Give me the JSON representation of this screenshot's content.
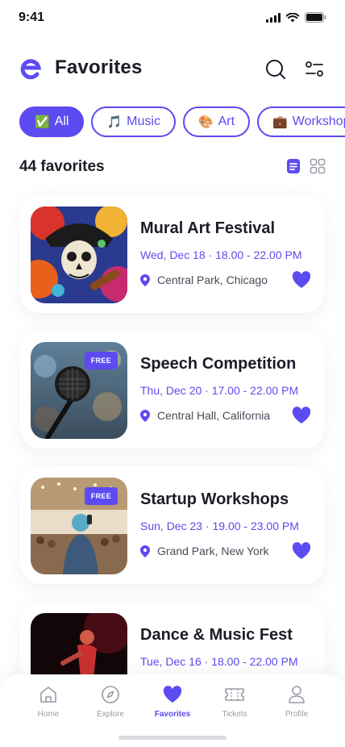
{
  "status_bar": {
    "time": "9:41"
  },
  "header": {
    "title": "Favorites",
    "search_icon": "search-icon",
    "filter_icon": "sliders-icon"
  },
  "chips": [
    {
      "emoji": "✅",
      "label": "All",
      "active": true
    },
    {
      "emoji": "🎵",
      "label": "Music",
      "active": false
    },
    {
      "emoji": "🎨",
      "label": "Art",
      "active": false
    },
    {
      "emoji": "💼",
      "label": "Workshops",
      "active": false
    }
  ],
  "count": {
    "text": "44 favorites",
    "active_view": "list"
  },
  "events": [
    {
      "title": "Mural Art Festival",
      "date": "Wed, Dec 18 · 18.00 - 22.00 PM",
      "location": "Central Park, Chicago",
      "badge": ""
    },
    {
      "title": "Speech Competition",
      "date": "Thu, Dec 20 · 17.00 - 22.00 PM",
      "location": "Central Hall, California",
      "badge": "FREE"
    },
    {
      "title": "Startup Workshops",
      "date": "Sun, Dec 23 · 19.00 - 23.00 PM",
      "location": "Grand Park, New York",
      "badge": "FREE"
    },
    {
      "title": "Dance & Music Fest",
      "date": "Tue, Dec 16 · 18.00 - 22.00 PM",
      "location": "",
      "badge": ""
    }
  ],
  "bottom_nav": [
    {
      "label": "Home",
      "icon": "home-icon"
    },
    {
      "label": "Explore",
      "icon": "compass-icon"
    },
    {
      "label": "Favorites",
      "icon": "heart-icon",
      "active": true
    },
    {
      "label": "Tickets",
      "icon": "ticket-icon"
    },
    {
      "label": "Profile",
      "icon": "user-icon"
    }
  ],
  "colors": {
    "accent": "#5b4bf0",
    "text": "#1c1c28",
    "muted": "#9a9aa8"
  }
}
